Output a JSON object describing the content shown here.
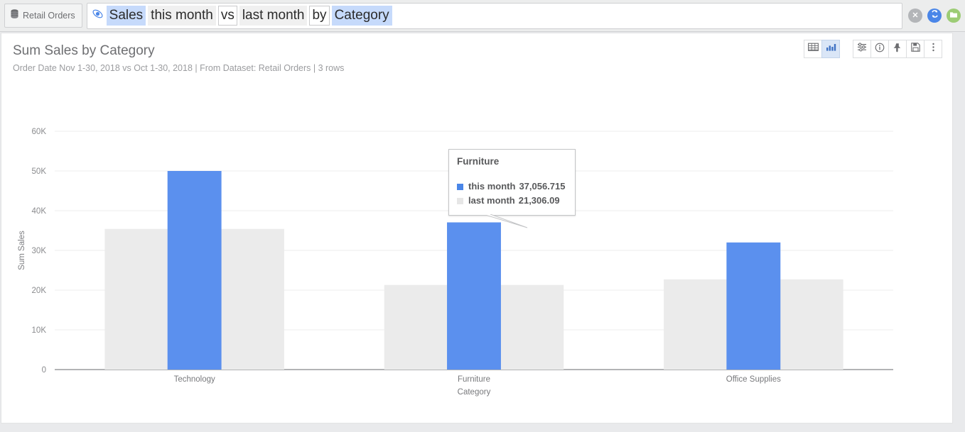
{
  "topbar": {
    "dataset_tab": {
      "label": "Retail Orders",
      "icon": "database-icon"
    },
    "search": {
      "icon": "search-atom-icon",
      "tokens": [
        {
          "text": "Sales",
          "style": "blue"
        },
        {
          "text": "this month",
          "style": "grey"
        },
        {
          "text": "vs",
          "style": "kw"
        },
        {
          "text": "last month",
          "style": "grey"
        },
        {
          "text": "by",
          "style": "kw"
        },
        {
          "text": "Category",
          "style": "blue"
        }
      ],
      "full_query": "Sales this month vs last month by Category"
    },
    "actions": [
      {
        "name": "clear-button",
        "icon": "close-icon",
        "color": "#b3b5b8"
      },
      {
        "name": "refresh-button",
        "icon": "refresh-icon",
        "color": "#4a86e8"
      },
      {
        "name": "open-folder-button",
        "icon": "folder-icon",
        "color": "#9ccc75"
      }
    ]
  },
  "card": {
    "title": "Sum Sales by Category",
    "subtitle": "Order Date Nov 1-30, 2018 vs Oct 1-30, 2018 | From Dataset: Retail Orders | 3 rows",
    "toolbar": [
      {
        "name": "table-view-button",
        "icon": "table-icon",
        "active": false
      },
      {
        "name": "chart-view-button",
        "icon": "bar-chart-icon",
        "active": true
      },
      {
        "name": "chart-config-button",
        "icon": "settings-list-icon",
        "active": false
      },
      {
        "name": "info-button",
        "icon": "info-icon",
        "active": false
      },
      {
        "name": "pin-button",
        "icon": "pin-icon",
        "active": false
      },
      {
        "name": "save-button",
        "icon": "floppy-save-icon",
        "active": false
      },
      {
        "name": "more-options-button",
        "icon": "kebab-menu-icon",
        "active": false
      }
    ]
  },
  "tooltip": {
    "title": "Furniture",
    "rows": [
      {
        "series": "this month",
        "value": "37,056.715",
        "color": "#4a86e8"
      },
      {
        "series": "last month",
        "value": "21,306.09",
        "color": "#e6e6e6"
      }
    ]
  },
  "chart_data": {
    "type": "bar",
    "title": "Sum Sales by Category",
    "subtitle": "Order Date Nov 1-30, 2018 vs Oct 1-30, 2018 | From Dataset: Retail Orders | 3 rows",
    "xlabel": "Category",
    "ylabel": "Sum Sales",
    "categories": [
      "Technology",
      "Furniture",
      "Office Supplies"
    ],
    "series": [
      {
        "name": "last month",
        "color": "#ebebeb",
        "values": [
          35400,
          21306.09,
          22700
        ]
      },
      {
        "name": "this month",
        "color": "#5b90ee",
        "values": [
          50000,
          37056.715,
          32000
        ]
      }
    ],
    "ylim": [
      0,
      60000
    ],
    "yticks": [
      0,
      10000,
      20000,
      30000,
      40000,
      50000,
      60000
    ],
    "ytick_labels": [
      "0",
      "10K",
      "20K",
      "30K",
      "40K",
      "50K",
      "60K"
    ],
    "grid": true,
    "legend": "none"
  }
}
